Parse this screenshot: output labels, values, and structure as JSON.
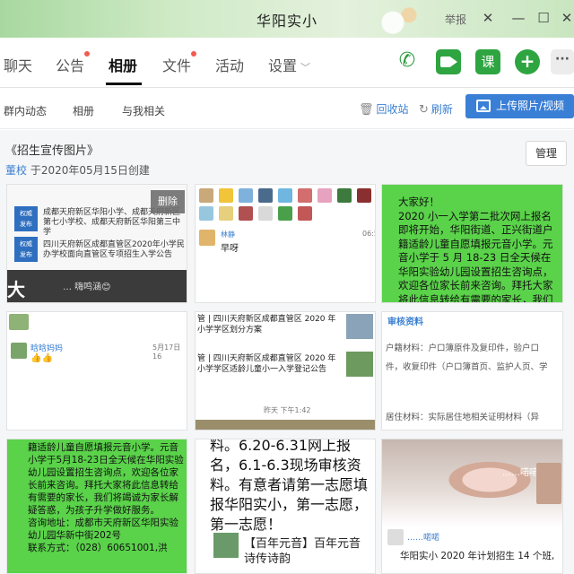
{
  "window": {
    "title": "华阳实小",
    "report": "举报"
  },
  "tabs": [
    {
      "label": "聊天"
    },
    {
      "label": "公告"
    },
    {
      "label": "相册"
    },
    {
      "label": "文件"
    },
    {
      "label": "活动"
    },
    {
      "label": "设置"
    }
  ],
  "toolbar": {
    "course": "课",
    "add": "+",
    "more": "···"
  },
  "subtabs": [
    "群内动态",
    "相册",
    "与我相关"
  ],
  "actions": {
    "recycle": "回收站",
    "refresh": "刷新",
    "upload": "上传照片/视频"
  },
  "album": {
    "title": "《招生宣传图片》",
    "author": "董校",
    "created": "于2020年05月15日创建",
    "manage": "管理"
  },
  "photos": {
    "p1": {
      "delete": "删除",
      "badge": "权威\n发布",
      "line1": "成都天府新区华阳小学、成都天府新区第七小学校、成都天府新区华阳第三中学",
      "line2": "四川天府新区成都直管区2020年小学民办学校面向直管区专项招生入学公告",
      "bottom_big": "大",
      "bottom_msg": "… 嗨鸣涵😊"
    },
    "p2": {
      "name": "林静",
      "msg": "早呀",
      "time": "06:5"
    },
    "p3": {
      "text": "大家好！\n2020 小一入学第二批次网上报名即将开始，华阳街道、正兴街道户籍适龄儿童自愿填报元音小学。元音小学于 5 月 18-23 日全天候在华阳实验幼儿园设置招生咨询点，欢迎各位家长前来咨询。拜托大家将此信息转给有需要的家长，我们将竭"
    },
    "p4": {
      "name": "晗晗妈妈",
      "time": "5月17日 16",
      "emoji": "👍👍"
    },
    "p5": {
      "line1": "管 | 四川天府新区成都直管区 2020 年小学学区划分方案",
      "line2": "管 | 四川天府新区成都直管区 2020 年小学学区适龄儿童小一入学登记公告",
      "time": "昨天 下午1:42"
    },
    "p6": {
      "title": "审核资料",
      "l1": "户籍材料：户口簿原件及复印件，验户口",
      "l2": "件，收复印件（户口簿首页、监护人页、学",
      "l3": "居住材料：实际居住地相关证明材料（异"
    },
    "p7": {
      "text": "籍适龄儿童自愿填报元音小学。元音小学于5月18-23日全天候在华阳实验幼儿园设置招生咨询点，欢迎各位家长前来咨询。拜托大家将此信息转给有需要的家长，我们将竭诚为家长解疑答惑，为孩子升学做好服务。\n咨询地址：成都市天府新区华阳实验幼儿园华新中街202号\n联系方式：（028）60651001,洪"
    },
    "p8": {
      "text": "料。6.20-6.31网上报名，6.1-6.3现场审核资料。有意者请第一志愿填报华阳实小，第一志愿，第一志愿！",
      "footer": "【百年元音】百年元音 诗传诗韵"
    },
    "p9": {
      "overlay": "……喏喏",
      "name": "……喏喏",
      "caption": "华阳实小 2020 年计划招生 14 个班,"
    }
  }
}
